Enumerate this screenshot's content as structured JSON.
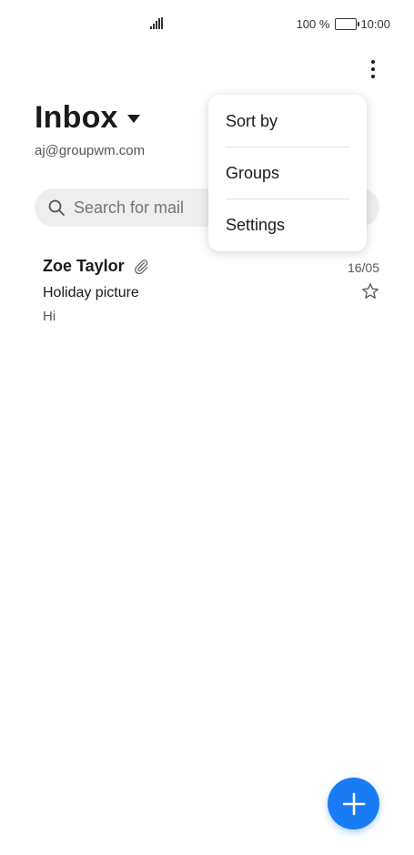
{
  "status_bar": {
    "battery_percent": "100 %",
    "time": "10:00",
    "icons": [
      "signal-icon",
      "battery-icon"
    ]
  },
  "header": {
    "title": "Inbox",
    "account": "aj@groupwm.com"
  },
  "search": {
    "placeholder": "Search for mail"
  },
  "mails": [
    {
      "sender": "Zoe Taylor",
      "date": "16/05",
      "subject": "Holiday picture",
      "preview": "Hi",
      "has_attachment": true,
      "starred": false
    }
  ],
  "menu": {
    "items": [
      {
        "label": "Sort by"
      },
      {
        "label": "Groups"
      },
      {
        "label": "Settings"
      }
    ]
  },
  "colors": {
    "accent": "#1a7cf5",
    "background": "#ffffff",
    "search_bg": "#eeeeee"
  }
}
